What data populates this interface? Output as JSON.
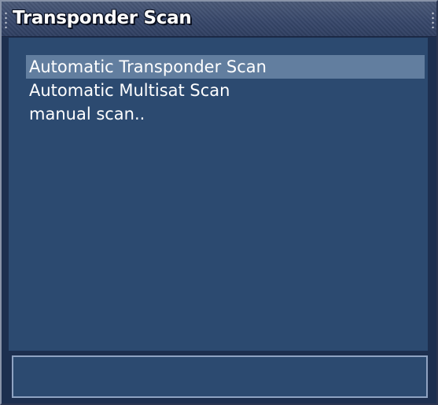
{
  "window": {
    "title": "Transponder Scan"
  },
  "menu": {
    "items": [
      {
        "label": "Automatic Transponder Scan",
        "selected": true
      },
      {
        "label": "Automatic Multisat Scan",
        "selected": false
      },
      {
        "label": "manual scan..",
        "selected": false
      }
    ]
  },
  "colors": {
    "background": "#2c4a70",
    "selection": "#627e9f",
    "titlebar": "#3c4c6e",
    "text": "#ffffff"
  }
}
